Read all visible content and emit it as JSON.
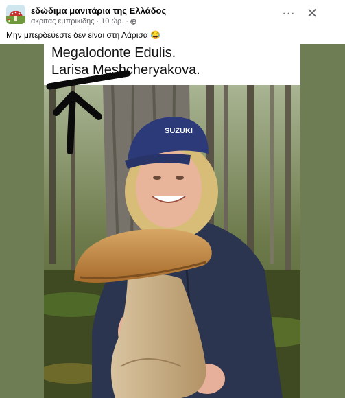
{
  "post": {
    "group_name": "εδώδιμα μανιτάρια της Ελλάδος",
    "author": "ακριτας εμπρικιδης",
    "separator": "·",
    "time": "10 ώρ.",
    "caption": "Μην μπερδεύεστε δεν είναι στη Λάρισα 😂",
    "more_label": "···",
    "close_label": "✕"
  },
  "photo": {
    "line1": "Megalodonte Edulis.",
    "line2": "Larisa Meshcheryakova.",
    "cap_logo": "SUZUKI"
  },
  "colors": {
    "side_background": "#6f7d55",
    "meta_text": "#65676b"
  },
  "icons": {
    "avatar": "group-avatar-mushroom",
    "globe": "globe-icon",
    "more": "more-options-icon",
    "close": "close-icon"
  }
}
